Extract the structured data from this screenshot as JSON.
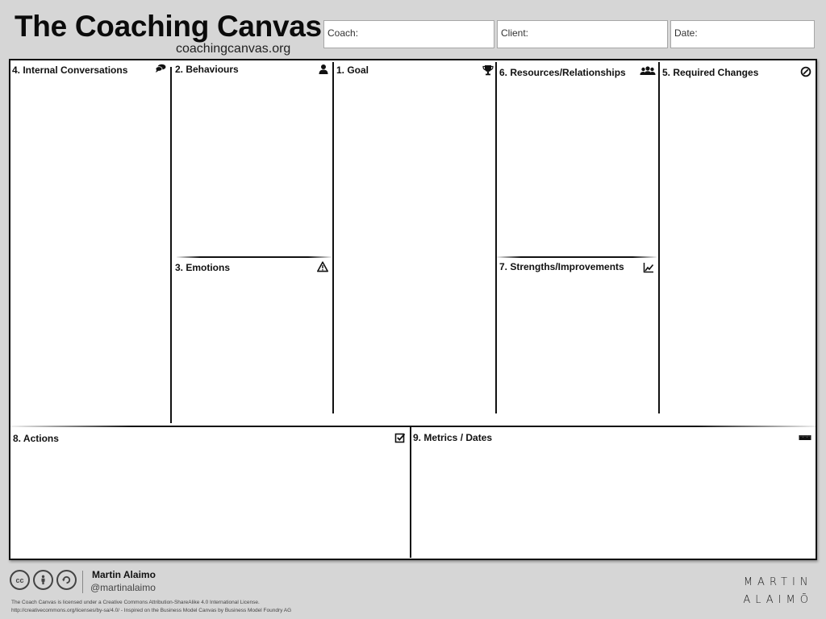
{
  "header": {
    "title": "The Coaching Canvas",
    "website": "coachingcanvas.org",
    "fields": [
      {
        "label": "Coach:",
        "value": ""
      },
      {
        "label": "Client:",
        "value": ""
      },
      {
        "label": "Date:",
        "value": ""
      }
    ]
  },
  "blocks": {
    "internal_conversations": {
      "label": "4. Internal Conversations",
      "icon": "speech-bubbles-icon"
    },
    "behaviours": {
      "label": "2. Behaviours",
      "icon": "user-icon"
    },
    "emotions": {
      "label": "3. Emotions",
      "icon": "warning-triangle-icon"
    },
    "goal": {
      "label": "1. Goal",
      "icon": "trophy-icon"
    },
    "resources": {
      "label": "6. Resources/Relationships",
      "icon": "group-icon"
    },
    "strengths": {
      "label": "7. Strengths/Improvements",
      "icon": "line-chart-icon"
    },
    "required_changes": {
      "label": "5. Required Changes",
      "icon": "no-entry-icon"
    },
    "actions": {
      "label": "8. Actions",
      "icon": "checkbox-icon"
    },
    "metrics": {
      "label": "9. Metrics / Dates",
      "icon": "ruler-icon"
    }
  },
  "footer": {
    "cc_icons": [
      "cc",
      "by",
      "sa"
    ],
    "author_name": "Martin Alaimo",
    "author_handle": "@martinalaimo",
    "license_line1": "The Coach Canvas is licensed under a Creative Commons Attribution-ShareAlike 4.0 International License.",
    "license_line2": "http://creativecommons.org/licenses/by-sa/4.0/ - Inspired on the Business Model Canvas by Business Model Foundry AG",
    "brand_line1": "MARTIN",
    "brand_line2": "ALAIMŌ"
  }
}
